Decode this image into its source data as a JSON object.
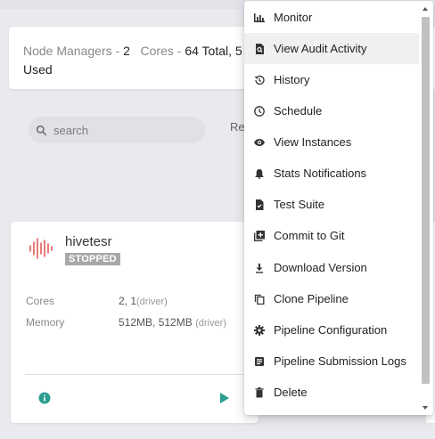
{
  "summary": {
    "node_managers_label": "Node Managers - ",
    "node_managers_value": "2",
    "cores_label": "Cores - ",
    "cores_value": "64 Total, 5",
    "cores_line2": "Used"
  },
  "search": {
    "placeholder": "search",
    "partial_label": "Re"
  },
  "node": {
    "name": "hivetesr",
    "status": "STOPPED",
    "cores_label": "Cores",
    "cores_value": "2, 1",
    "cores_sub": "(driver)",
    "memory_label": "Memory",
    "memory_value": "512MB, 512MB",
    "memory_sub": "(driver)",
    "colors": {
      "wave": "#e35a5a",
      "status_bg": "#a8a8a8",
      "info": "#2a9d8f",
      "play": "#2a9d8f"
    }
  },
  "menu": {
    "items": [
      {
        "label": "Monitor",
        "icon": "bar-chart-icon"
      },
      {
        "label": "View Audit Activity",
        "icon": "audit-doc-icon"
      },
      {
        "label": "History",
        "icon": "history-icon"
      },
      {
        "label": "Schedule",
        "icon": "clock-icon"
      },
      {
        "label": "View Instances",
        "icon": "eye-icon"
      },
      {
        "label": "Stats Notifications",
        "icon": "bell-icon"
      },
      {
        "label": "Test Suite",
        "icon": "test-file-icon"
      },
      {
        "label": "Commit to Git",
        "icon": "add-box-icon"
      },
      {
        "label": "Download Version",
        "icon": "download-icon"
      },
      {
        "label": "Clone Pipeline",
        "icon": "copy-icon"
      },
      {
        "label": "Pipeline Configuration",
        "icon": "gear-icon"
      },
      {
        "label": "Pipeline Submission Logs",
        "icon": "logs-icon"
      },
      {
        "label": "Delete",
        "icon": "trash-icon"
      }
    ],
    "hovered": "View Audit Activity"
  }
}
